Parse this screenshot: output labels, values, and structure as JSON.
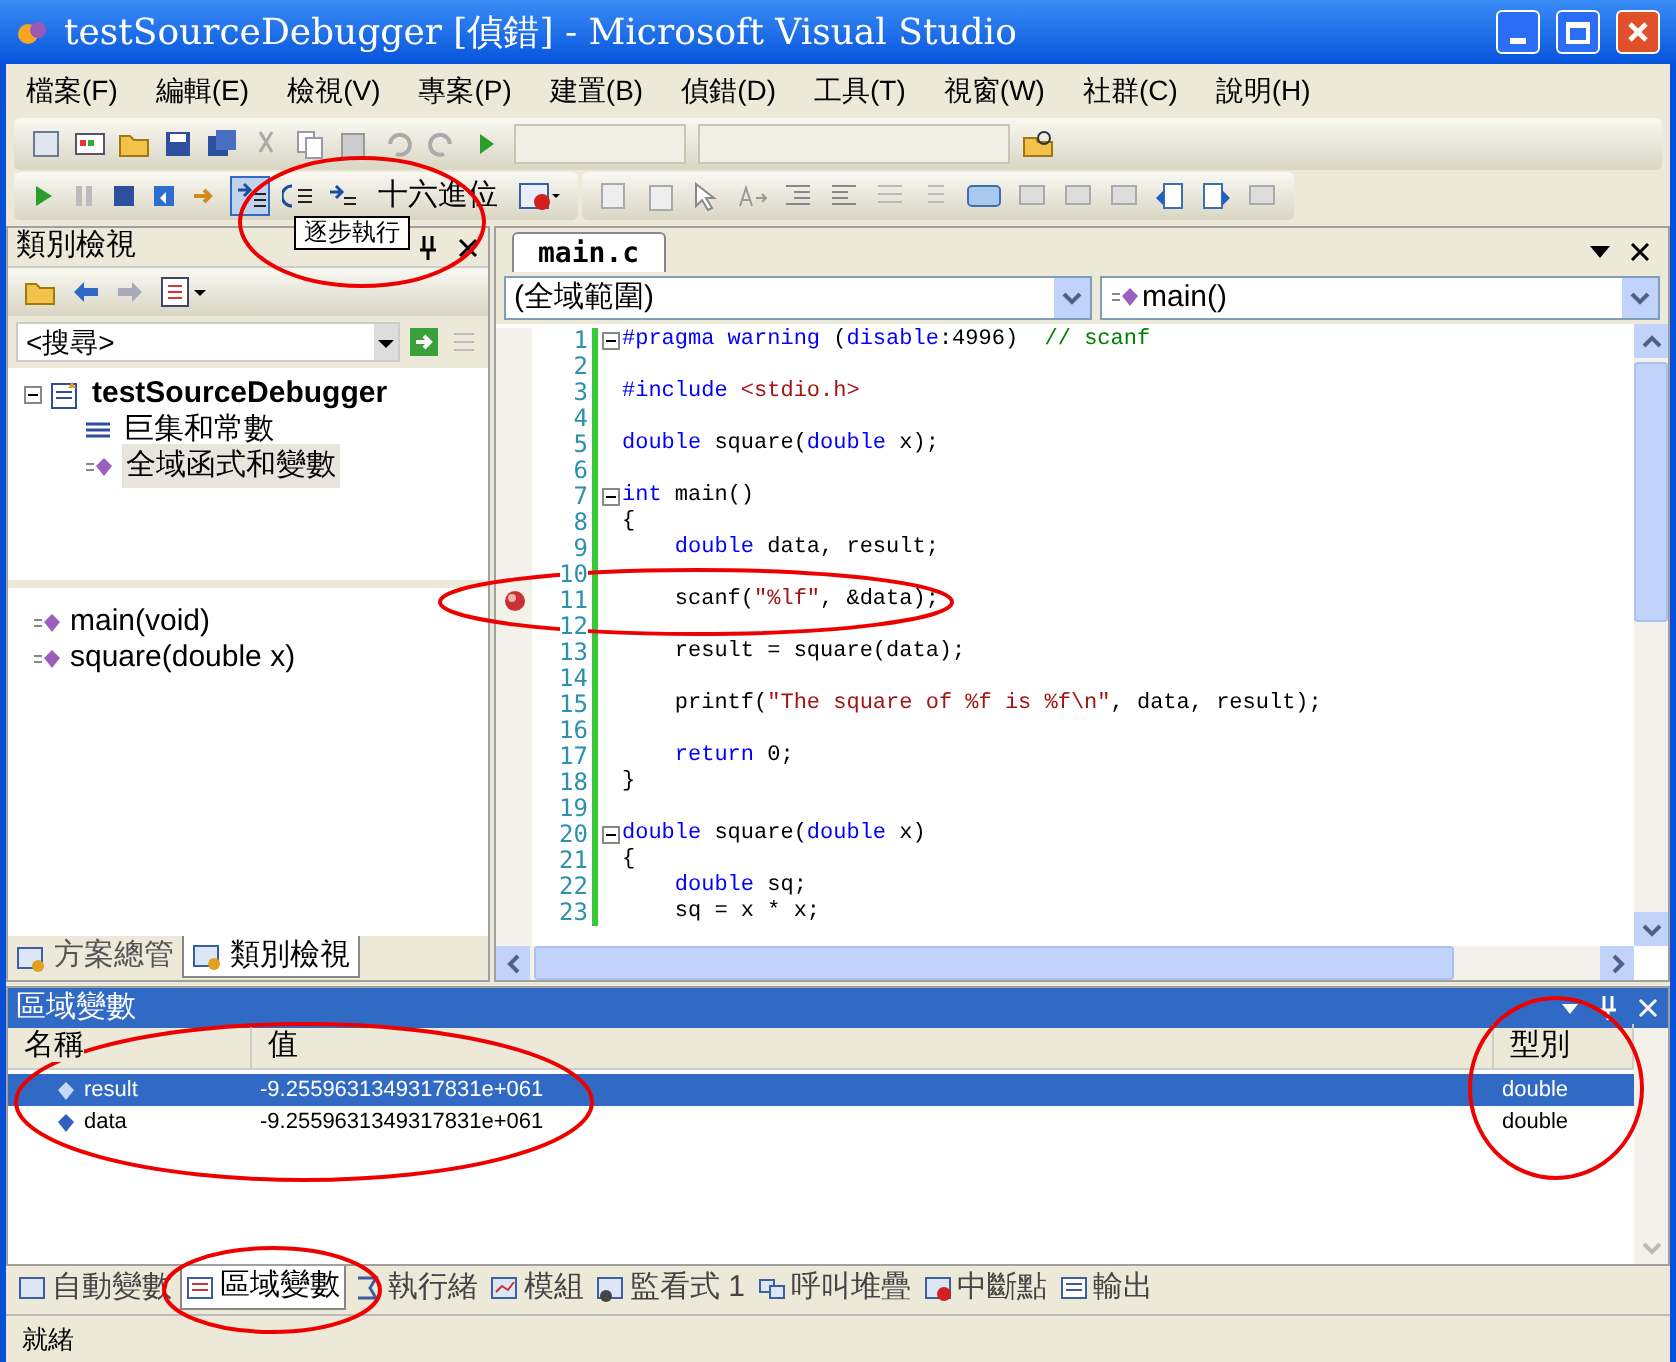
{
  "window": {
    "title": "testSourceDebugger [偵錯] - Microsoft Visual Studio"
  },
  "menu": [
    "檔案(F)",
    "編輯(E)",
    "檢視(V)",
    "專案(P)",
    "建置(B)",
    "偵錯(D)",
    "工具(T)",
    "視窗(W)",
    "社群(C)",
    "說明(H)"
  ],
  "debug_toolbar": {
    "hex_button": "十六進位",
    "tooltip": "逐步執行"
  },
  "class_view": {
    "title": "類別檢視",
    "search": {
      "value": "<搜尋>"
    },
    "tree": [
      {
        "label": "testSourceDebugger",
        "expanded": true,
        "selected": false,
        "children": [
          {
            "label": "巨集和常數",
            "selected": false
          },
          {
            "label": "全域函式和變數",
            "selected": true
          }
        ]
      }
    ],
    "members": [
      "main(void)",
      "square(double x)"
    ],
    "tabs": [
      {
        "label": "方案總管",
        "selected": false
      },
      {
        "label": "類別檢視",
        "selected": true
      }
    ]
  },
  "editor": {
    "tabs": [
      {
        "label": "main.c",
        "selected": true
      }
    ],
    "scope": "(全域範圍)",
    "member": "main()",
    "lines": [
      {
        "number": "1",
        "fold": true,
        "breakpoint": false,
        "segments": [
          {
            "kind": "keyword",
            "text": "#pragma warning"
          },
          {
            "kind": "plain",
            "text": " ("
          },
          {
            "kind": "keyword",
            "text": "disable"
          },
          {
            "kind": "plain",
            "text": ":4996)  "
          },
          {
            "kind": "comment",
            "text": "// scanf"
          }
        ]
      },
      {
        "number": "2",
        "fold": false,
        "breakpoint": false
      },
      {
        "number": "3",
        "fold": false,
        "breakpoint": false,
        "segments": [
          {
            "kind": "keyword",
            "text": "#include "
          },
          {
            "kind": "string",
            "text": "<stdio.h>"
          }
        ]
      },
      {
        "number": "4",
        "fold": false,
        "breakpoint": false
      },
      {
        "number": "5",
        "fold": false,
        "breakpoint": false,
        "segments": [
          {
            "kind": "keyword",
            "text": "double"
          },
          {
            "kind": "plain",
            "text": " square("
          },
          {
            "kind": "keyword",
            "text": "double"
          },
          {
            "kind": "plain",
            "text": " x);"
          }
        ]
      },
      {
        "number": "6",
        "fold": false,
        "breakpoint": false
      },
      {
        "number": "7",
        "fold": true,
        "breakpoint": false,
        "segments": [
          {
            "kind": "keyword",
            "text": "int"
          },
          {
            "kind": "plain",
            "text": " main()"
          }
        ]
      },
      {
        "number": "8",
        "fold": false,
        "breakpoint": false,
        "segments": [
          {
            "kind": "plain",
            "text": "{"
          }
        ]
      },
      {
        "number": "9",
        "fold": false,
        "breakpoint": false,
        "segments": [
          {
            "kind": "keyword",
            "text": "    double"
          },
          {
            "kind": "plain",
            "text": " data, result;"
          }
        ]
      },
      {
        "number": "10",
        "fold": false,
        "breakpoint": false
      },
      {
        "number": "11",
        "fold": false,
        "breakpoint": true,
        "segments": [
          {
            "kind": "plain",
            "text": "    scanf("
          },
          {
            "kind": "string",
            "text": "\"%lf\""
          },
          {
            "kind": "plain",
            "text": ", &data);"
          }
        ]
      },
      {
        "number": "12",
        "fold": false,
        "breakpoint": false
      },
      {
        "number": "13",
        "fold": false,
        "breakpoint": false,
        "segments": [
          {
            "kind": "plain",
            "text": "    result = square(data);"
          }
        ]
      },
      {
        "number": "14",
        "fold": false,
        "breakpoint": false
      },
      {
        "number": "15",
        "fold": false,
        "breakpoint": false,
        "segments": [
          {
            "kind": "plain",
            "text": "    printf("
          },
          {
            "kind": "string",
            "text": "\"The square of %f is %f\\n\""
          },
          {
            "kind": "plain",
            "text": ", data, result);"
          }
        ]
      },
      {
        "number": "16",
        "fold": false,
        "breakpoint": false
      },
      {
        "number": "17",
        "fold": false,
        "breakpoint": false,
        "segments": [
          {
            "kind": "keyword",
            "text": "    return"
          },
          {
            "kind": "plain",
            "text": " 0;"
          }
        ]
      },
      {
        "number": "18",
        "fold": false,
        "breakpoint": false,
        "segments": [
          {
            "kind": "plain",
            "text": "}"
          }
        ]
      },
      {
        "number": "19",
        "fold": false,
        "breakpoint": false
      },
      {
        "number": "20",
        "fold": true,
        "breakpoint": false,
        "segments": [
          {
            "kind": "keyword",
            "text": "double"
          },
          {
            "kind": "plain",
            "text": " square("
          },
          {
            "kind": "keyword",
            "text": "double"
          },
          {
            "kind": "plain",
            "text": " x)"
          }
        ]
      },
      {
        "number": "21",
        "fold": false,
        "breakpoint": false,
        "segments": [
          {
            "kind": "plain",
            "text": "{"
          }
        ]
      },
      {
        "number": "22",
        "fold": false,
        "breakpoint": false,
        "segments": [
          {
            "kind": "keyword",
            "text": "    double"
          },
          {
            "kind": "plain",
            "text": " sq;"
          }
        ]
      },
      {
        "number": "23",
        "fold": false,
        "breakpoint": false,
        "segments": [
          {
            "kind": "plain",
            "text": "    sq = x * x;"
          }
        ]
      }
    ]
  },
  "locals": {
    "title": "區域變數",
    "columns": [
      "名稱",
      "值",
      "型別"
    ],
    "rows": [
      {
        "name": "result",
        "value": "-9.2559631349317831e+061",
        "type": "double",
        "selected": true
      },
      {
        "name": "data",
        "value": "-9.2559631349317831e+061",
        "type": "double",
        "selected": false
      }
    ]
  },
  "bottom_tabs": [
    {
      "label": "自動變數",
      "selected": false
    },
    {
      "label": "區域變數",
      "selected": true
    },
    {
      "label": "執行緒",
      "selected": false
    },
    {
      "label": "模組",
      "selected": false
    },
    {
      "label": "監看式 1",
      "selected": false
    },
    {
      "label": "呼叫堆疊",
      "selected": false
    },
    {
      "label": "中斷點",
      "selected": false
    },
    {
      "label": "輸出",
      "selected": false
    }
  ],
  "status_bar": "就緒"
}
